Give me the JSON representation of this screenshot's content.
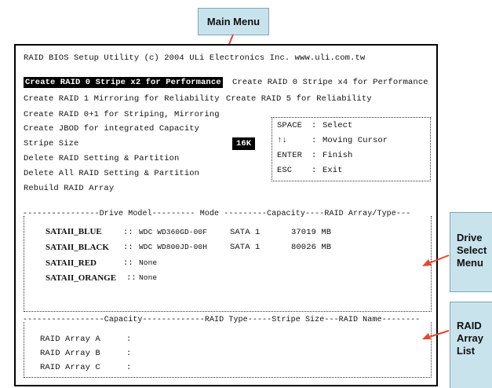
{
  "callouts": {
    "main_menu": "Main Menu",
    "drive_select": [
      "Drive",
      "Select",
      "Menu"
    ],
    "raid_array": [
      "RAID",
      "Array",
      "List"
    ]
  },
  "header": "RAID BIOS Setup Utility (c) 2004 ULi Electronics Inc.    www.uli.com.tw",
  "menu": {
    "selected": "Create RAID 0 Stripe x2 for Performance",
    "items": [
      "Create RAID 0 Stripe x4 for Performance",
      "Create RAID 1 Mirroring for Reliability",
      "Create RAID 5 for Reliability",
      "Create RAID 0+1 for Striping, Mirroring",
      "Create JBOD for integrated Capacity",
      "Stripe Size",
      "Delete RAID Setting & Partition",
      "Delete All RAID Setting & Partition",
      "Rebuild RAID Array"
    ],
    "stripe_value": "16K"
  },
  "help": {
    "rows": [
      {
        "key": "SPACE",
        "sep": ":",
        "desc": "Select"
      },
      {
        "key": "↑↓",
        "sep": ":",
        "desc": "Moving Cursor"
      },
      {
        "key": "ENTER",
        "sep": ":",
        "desc": "Finish"
      },
      {
        "key": "ESC",
        "sep": ":",
        "desc": "Exit"
      }
    ]
  },
  "drives": {
    "header": "----------------Drive Model--------- Mode ---------Capacity----RAID Array/Type---",
    "rows": [
      {
        "port": "SATAII_BLUE",
        "sep": "::",
        "model": "WDC WD360GD-00F",
        "mode": "SATA 1",
        "capacity": "37019 MB"
      },
      {
        "port": "SATAII_BLACK",
        "sep": "::",
        "model": "WDC WD800JD-00H",
        "mode": "SATA 1",
        "capacity": "80026 MB"
      },
      {
        "port": "SATAII_RED",
        "sep": "::",
        "model": "None",
        "mode": "",
        "capacity": ""
      },
      {
        "port": "SATAII_ORANGE",
        "sep": "::",
        "model": "None",
        "mode": "",
        "capacity": ""
      }
    ]
  },
  "arrays": {
    "header": "-----------------Capacity-------------RAID Type-----Stripe Size---RAID Name--------",
    "rows": [
      {
        "name": "RAID Array A",
        "sep": ":"
      },
      {
        "name": "RAID Array B",
        "sep": ":"
      },
      {
        "name": "RAID Array C",
        "sep": ":"
      }
    ]
  },
  "colors": {
    "callout_bg": "#c9e3ec",
    "arrow": "#e8452b"
  }
}
